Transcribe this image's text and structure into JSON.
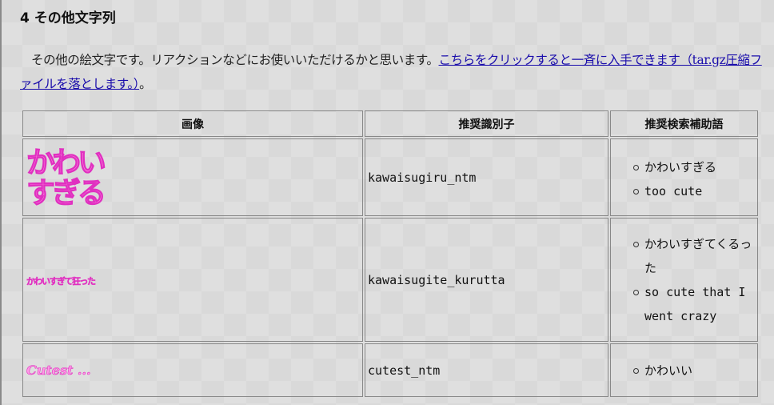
{
  "section": {
    "number": "4",
    "title": "その他文字列"
  },
  "intro": {
    "text": "その他の絵文字です。リアクションなどにお使いいただけるかと思います。",
    "link": "こちらをクリックすると一斉に入手できます（tar.gz圧縮ファイルを落とします。）",
    "tail": "。"
  },
  "table": {
    "headers": [
      "画像",
      "推奨識別子",
      "推奨検索補助語"
    ],
    "rows": [
      {
        "image_text": [
          "かわい",
          "すぎる"
        ],
        "id": "kawaisugiru_ntm",
        "keywords": [
          "かわいすぎる",
          "too cute"
        ]
      },
      {
        "image_text": "かわいすぎて狂った",
        "id": "kawaisugite_kurutta",
        "keywords": [
          "かわいすぎてくるった",
          "so cute that I went crazy"
        ]
      },
      {
        "image_text": "Cutest ...",
        "id": "cutest_ntm",
        "keywords": [
          "かわいい"
        ]
      }
    ]
  },
  "colors": {
    "link": "#1a0dab",
    "emoji_fill": "#ff86e0",
    "emoji_stroke": "#e030c0"
  }
}
